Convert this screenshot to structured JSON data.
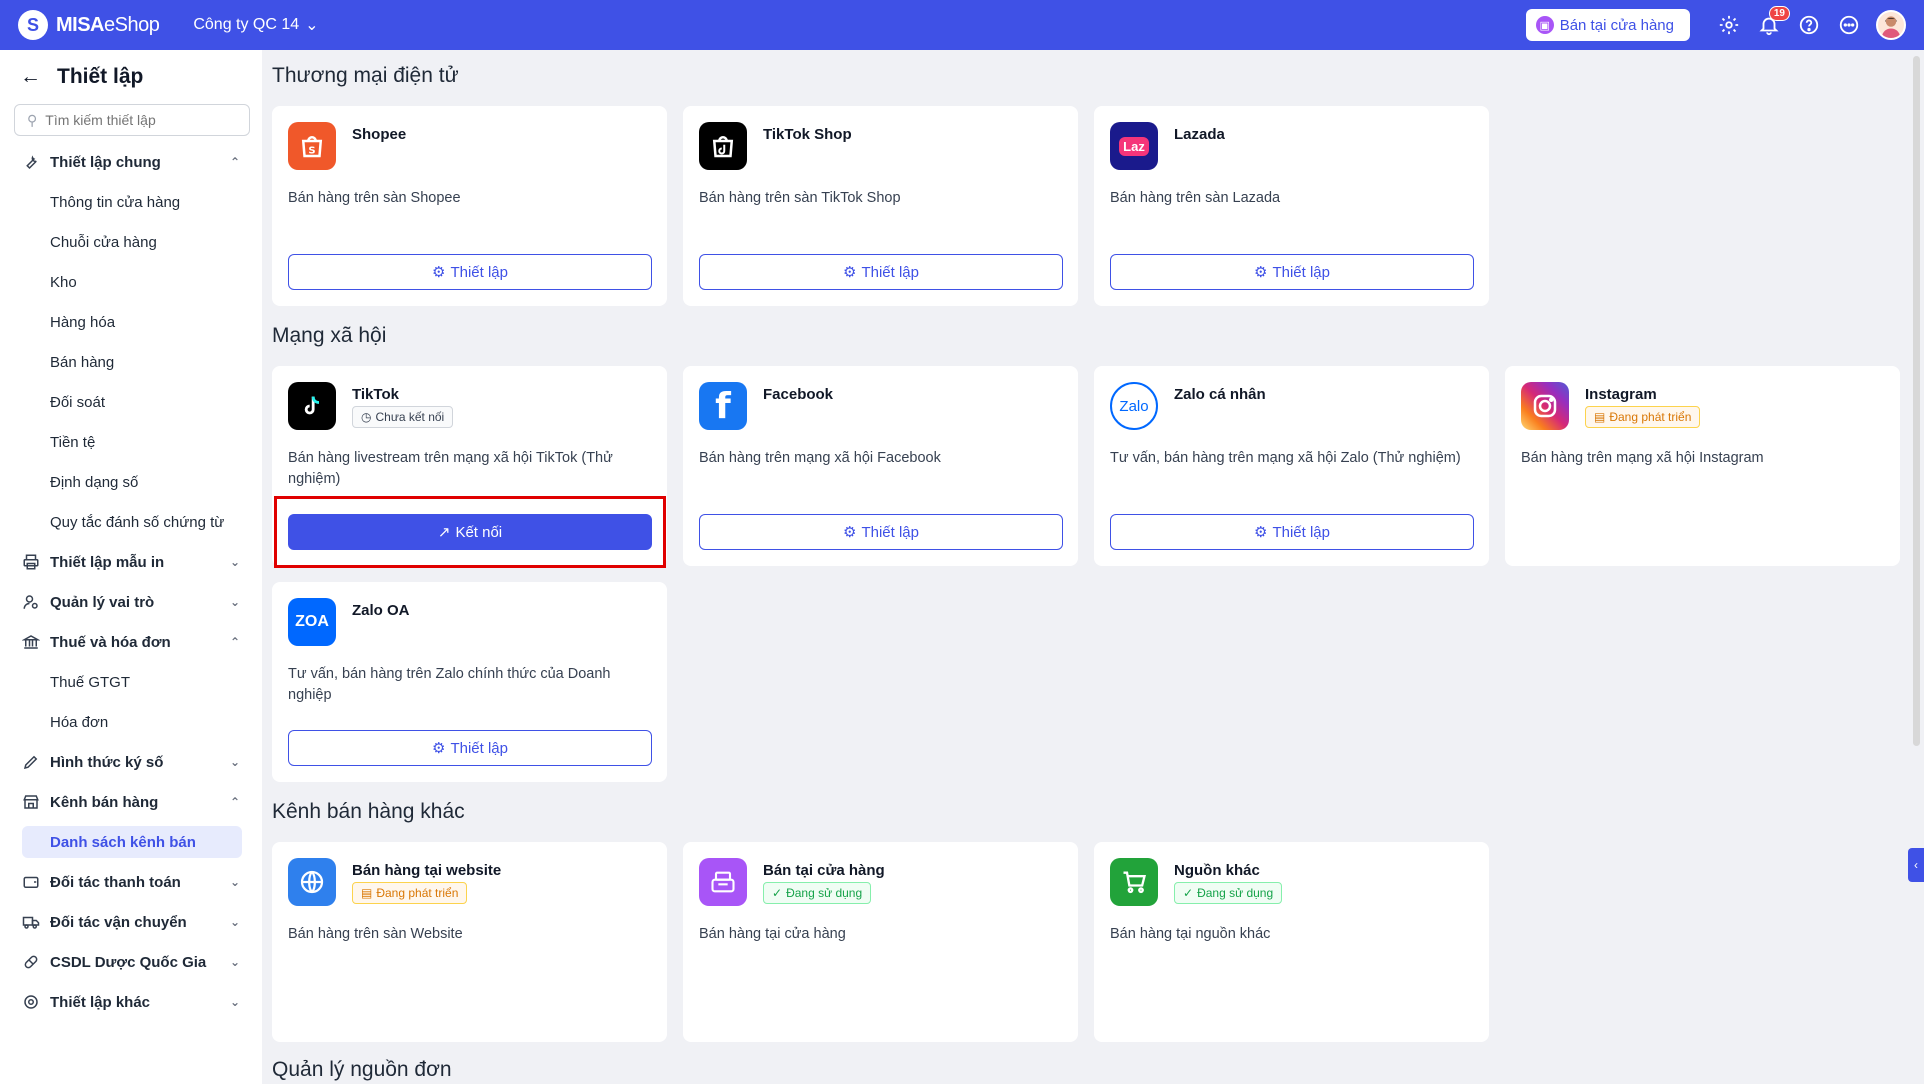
{
  "topbar": {
    "logo_bold": "MISA",
    "logo_thin": "eShop",
    "company": "Công ty QC 14",
    "store_button": "Bán tại cửa hàng",
    "notif_count": "19"
  },
  "sidebar": {
    "title": "Thiết lập",
    "search_placeholder": "Tìm kiếm thiết lập",
    "general": "Thiết lập chung",
    "general_items": [
      "Thông tin cửa hàng",
      "Chuỗi cửa hàng",
      "Kho",
      "Hàng hóa",
      "Bán hàng",
      "Đối soát",
      "Tiền tệ",
      "Định dạng số",
      "Quy tắc đánh số chứng từ"
    ],
    "print_templates": "Thiết lập mẫu in",
    "roles": "Quản lý vai trò",
    "tax": "Thuế và hóa đơn",
    "tax_items": [
      "Thuế GTGT",
      "Hóa đơn"
    ],
    "signing": "Hình thức ký số",
    "channels": "Kênh bán hàng",
    "channels_items": [
      "Danh sách kênh bán"
    ],
    "payment": "Đối tác thanh toán",
    "shipping": "Đối tác vận chuyển",
    "pharma": "CSDL Dược Quốc Gia",
    "other": "Thiết lập khác"
  },
  "sections": {
    "ecommerce": "Thương mại điện tử",
    "social": "Mạng xã hội",
    "other_channels": "Kênh bán hàng khác",
    "order_sources": "Quản lý nguồn đơn"
  },
  "cards": {
    "shopee": {
      "name": "Shopee",
      "desc": "Bán hàng trên sàn Shopee",
      "button": "Thiết lập"
    },
    "tiktokshop": {
      "name": "TikTok Shop",
      "desc": "Bán hàng trên sàn TikTok Shop",
      "button": "Thiết lập"
    },
    "lazada": {
      "name": "Lazada",
      "desc": "Bán hàng trên sàn Lazada",
      "button": "Thiết lập",
      "icon_text": "Laz"
    },
    "tiktok": {
      "name": "TikTok",
      "badge": "Chưa kết nối",
      "desc": "Bán hàng livestream trên mạng xã hội TikTok (Thử nghiệm)",
      "button": "Kết nối"
    },
    "facebook": {
      "name": "Facebook",
      "desc": "Bán hàng trên mạng xã hội Facebook",
      "button": "Thiết lập",
      "icon_text": "f"
    },
    "zalo": {
      "name": "Zalo cá nhân",
      "desc": "Tư vấn, bán hàng trên mạng xã hội Zalo (Thử nghiệm)",
      "button": "Thiết lập",
      "icon_text": "Zalo"
    },
    "instagram": {
      "name": "Instagram",
      "badge": "Đang phát triển",
      "desc": "Bán hàng trên mạng xã hội Instagram"
    },
    "zalooa": {
      "name": "Zalo OA",
      "desc": "Tư vấn, bán hàng trên Zalo chính thức của Doanh nghiệp",
      "button": "Thiết lập",
      "icon_text": "ZOA"
    },
    "website": {
      "name": "Bán hàng tại website",
      "badge": "Đang phát triển",
      "desc": "Bán hàng trên sàn Website"
    },
    "store": {
      "name": "Bán tại cửa hàng",
      "badge": "Đang sử dụng",
      "desc": "Bán hàng tại cửa hàng"
    },
    "othersrc": {
      "name": "Nguồn khác",
      "badge": "Đang sử dụng",
      "desc": "Bán hàng tại nguồn khác"
    }
  },
  "colors": {
    "accent": "#3f51e6",
    "shopee": "#f0582a",
    "lazada": "#1a1a8c",
    "facebook": "#1877f2",
    "zalooa": "#0068ff",
    "website": "#2f80ed",
    "store": "#a855f7",
    "othersrc": "#22a33a"
  }
}
